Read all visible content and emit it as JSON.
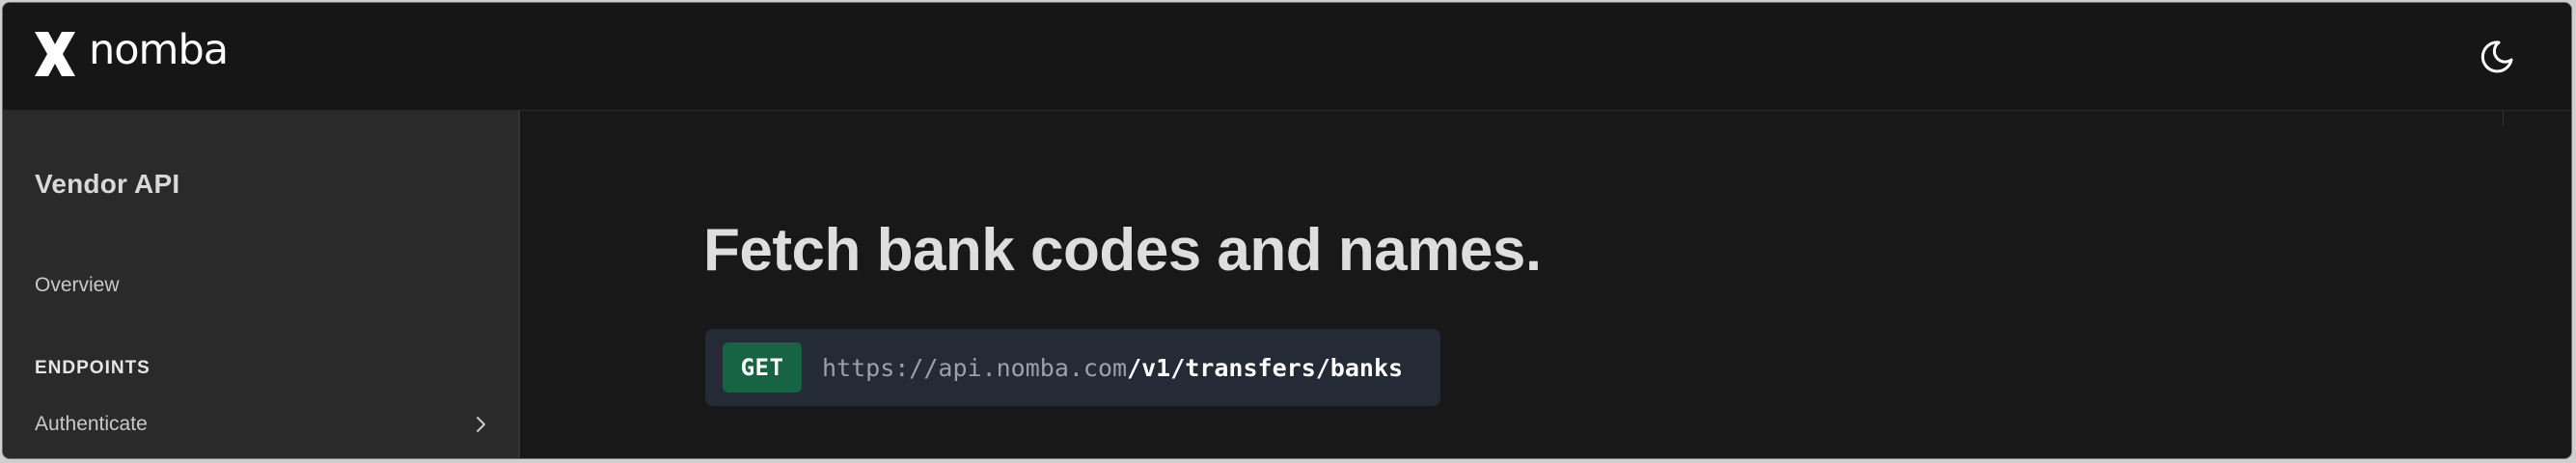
{
  "header": {
    "brand_name": "nomba",
    "logo_icon": "nomba-x-logo-icon",
    "theme_toggle_icon": "moon-icon"
  },
  "sidebar": {
    "title": "Vendor API",
    "overview_label": "Overview",
    "section_heading": "ENDPOINTS",
    "items": [
      {
        "label": "Authenticate",
        "icon": "chevron-right-icon"
      }
    ]
  },
  "main": {
    "title": "Fetch bank codes and names.",
    "endpoint": {
      "method": "GET",
      "base_url": "https://api.nomba.com",
      "path": "/v1/transfers/banks"
    }
  },
  "colors": {
    "background": "#181818",
    "sidebar_bg": "#2a2a2a",
    "endpoint_bg": "#242a36",
    "method_badge": "#176445",
    "text_primary": "#dedede"
  }
}
